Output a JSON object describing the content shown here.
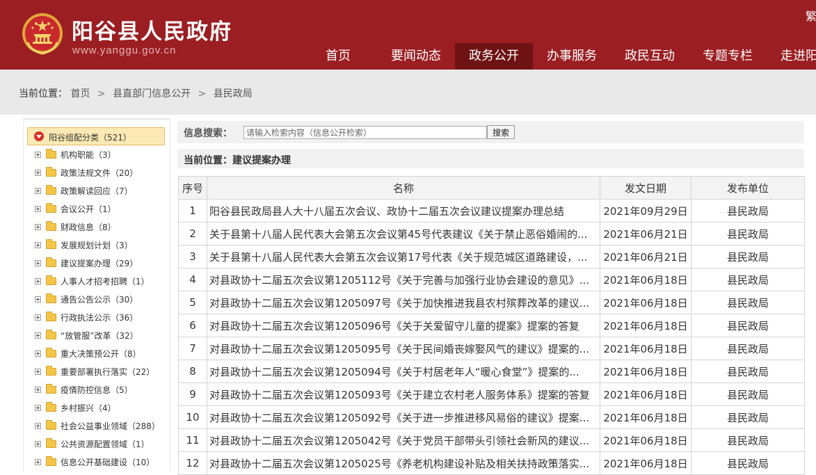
{
  "header": {
    "site_title": "阳谷县人民政府",
    "site_url": "www.yanggu.gov.cn",
    "lang_link": "繁",
    "nav": [
      {
        "label": "首页",
        "active": false
      },
      {
        "label": "要闻动态",
        "active": false
      },
      {
        "label": "政务公开",
        "active": true
      },
      {
        "label": "办事服务",
        "active": false
      },
      {
        "label": "政民互动",
        "active": false
      },
      {
        "label": "专题专栏",
        "active": false
      },
      {
        "label": "走进阳谷",
        "active": false
      }
    ]
  },
  "breadcrumb": {
    "label": "当前位置：",
    "items": [
      "首页",
      "县直部门信息公开",
      "县民政局"
    ],
    "separator": ">"
  },
  "sidebar": {
    "root_label": "阳谷组配分类（521）",
    "items": [
      {
        "label": "机构职能（3）"
      },
      {
        "label": "政策法规文件（20）"
      },
      {
        "label": "政策解读回应（7）"
      },
      {
        "label": "会议公开（1）"
      },
      {
        "label": "财政信息（8）"
      },
      {
        "label": "发展规划计划（3）"
      },
      {
        "label": "建议提案办理（29）"
      },
      {
        "label": "人事人才招考招聘（1）"
      },
      {
        "label": "通告公告公示（30）"
      },
      {
        "label": "行政执法公示（36）"
      },
      {
        "label": "“放管服”改革（32）"
      },
      {
        "label": "重大决策预公开（8）"
      },
      {
        "label": "重要部署执行落实（22）"
      },
      {
        "label": "疫情防控信息（5）"
      },
      {
        "label": "乡村振兴（4）"
      },
      {
        "label": "社会公益事业领域（288）"
      },
      {
        "label": "公共资源配置领域（1）"
      },
      {
        "label": "信息公开基础建设（10）"
      }
    ]
  },
  "search": {
    "label": "信息搜索：",
    "placeholder": "请输入检索内容（信息公开检索）",
    "button": "搜索"
  },
  "location": {
    "text": "当前位置：建议提案办理"
  },
  "table": {
    "headers": [
      "序号",
      "名称",
      "发文日期",
      "发布单位"
    ],
    "rows": [
      {
        "no": "1",
        "name": "阳谷县民政局县人大十八届五次会议、政协十二届五次会议建议提案办理总结",
        "date": "2021年09月29日",
        "unit": "县民政局"
      },
      {
        "no": "2",
        "name": "关于县第十八届人民代表大会第五次会议第45号代表建议《关于禁止恶俗婚闹的...",
        "date": "2021年06月21日",
        "unit": "县民政局"
      },
      {
        "no": "3",
        "name": "关于县第十八届人民代表大会第五次会议第17号代表《关于规范城区道路建设，...",
        "date": "2021年06月21日",
        "unit": "县民政局"
      },
      {
        "no": "4",
        "name": "对县政协十二届五次会议第1205112号《关于完善与加强行业协会建设的意见》...",
        "date": "2021年06月18日",
        "unit": "县民政局"
      },
      {
        "no": "5",
        "name": "对县政协十二届五次会议第1205097号《关于加快推进我县农村殡葬改革的建议...",
        "date": "2021年06月18日",
        "unit": "县民政局"
      },
      {
        "no": "6",
        "name": "对县政协十二届五次会议第1205096号《关于关爱留守儿童的提案》提案的答复",
        "date": "2021年06月18日",
        "unit": "县民政局"
      },
      {
        "no": "7",
        "name": "对县政协十二届五次会议第1205095号《关于民间婚丧嫁娶风气的建议》提案的...",
        "date": "2021年06月18日",
        "unit": "县民政局"
      },
      {
        "no": "8",
        "name": "对县政协十二届五次会议第1205094号《关于村居老年人“暖心食堂”》提案的...",
        "date": "2021年06月18日",
        "unit": "县民政局"
      },
      {
        "no": "9",
        "name": "对县政协十二届五次会议第1205093号《关于建立农村老人服务体系》提案的答复",
        "date": "2021年06月18日",
        "unit": "县民政局"
      },
      {
        "no": "10",
        "name": "对县政协十二届五次会议第1205092号《关于进一步推进移风易俗的建议》提案...",
        "date": "2021年06月18日",
        "unit": "县民政局"
      },
      {
        "no": "11",
        "name": "对县政协十二届五次会议第1205042号《关于党员干部带头引领社会新风的建议...",
        "date": "2021年06月18日",
        "unit": "县民政局"
      },
      {
        "no": "12",
        "name": "对县政协十二届五次会议第1205025号《养老机构建设补贴及相关扶持政策落实...",
        "date": "2021年06月18日",
        "unit": "县民政局"
      }
    ]
  }
}
